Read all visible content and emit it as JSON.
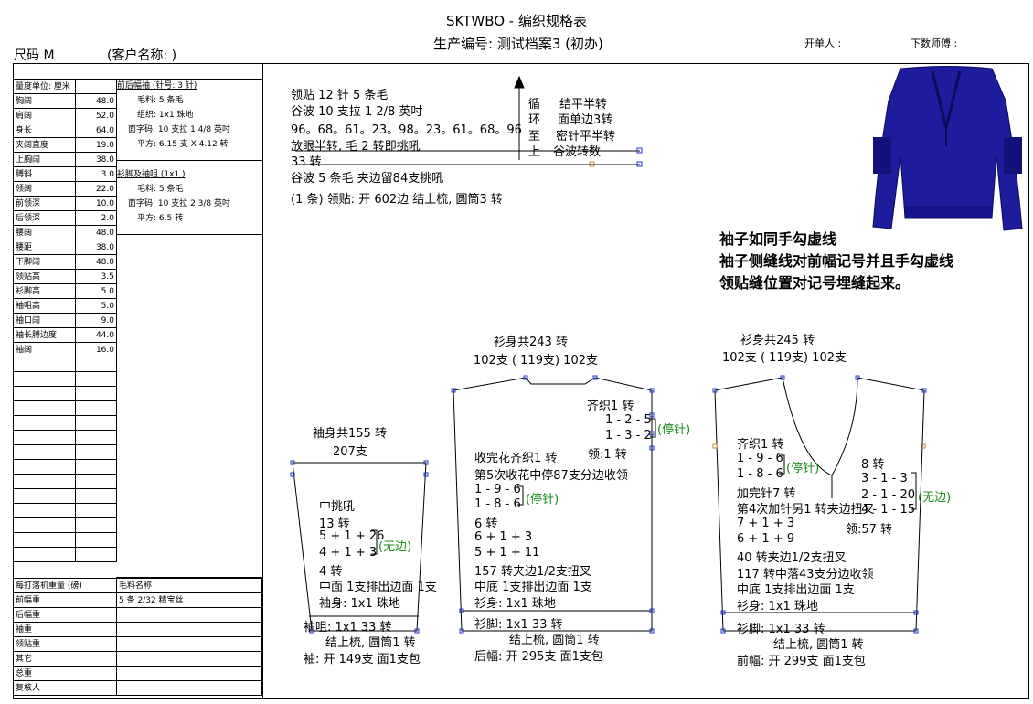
{
  "header": {
    "title": "SKTWBO - 编织规格表",
    "production_no": "生产编号: 测试档案3 (初办)",
    "size": "尺码  M",
    "customer": "(客户名称: )",
    "issuer": "开单人 :",
    "writer": "下数师傅 :"
  },
  "measure_table": {
    "unit_label": "量度单位: 厘米",
    "rows": [
      {
        "label": "胸阔",
        "value": "48.0"
      },
      {
        "label": "肩阔",
        "value": "52.0"
      },
      {
        "label": "身长",
        "value": "64.0"
      },
      {
        "label": "夹阔直度",
        "value": "19.0"
      },
      {
        "label": "上胸阔",
        "value": "38.0"
      },
      {
        "label": "膊斜",
        "value": "3.0"
      },
      {
        "label": "领阔",
        "value": "22.0"
      },
      {
        "label": "前领深",
        "value": "10.0"
      },
      {
        "label": "后领深",
        "value": "2.0"
      },
      {
        "label": "腰阔",
        "value": "48.0"
      },
      {
        "label": "腰距",
        "value": "38.0"
      },
      {
        "label": "下脚阔",
        "value": "48.0"
      },
      {
        "label": "领贴高",
        "value": "3.5"
      },
      {
        "label": "衫脚高",
        "value": "5.0"
      },
      {
        "label": "袖咀高",
        "value": "5.0"
      },
      {
        "label": "袖口阔",
        "value": "9.0"
      },
      {
        "label": "袖长膊边度",
        "value": "44.0"
      },
      {
        "label": "袖阔",
        "value": "16.0"
      }
    ]
  },
  "panel_notes": {
    "s1_title": "前后幅袖 (针号: 3 针)",
    "s1_lines": [
      "毛料: 5 条毛",
      "组织: 1x1  珠地",
      "面字码: 10 支拉 1 4/8 英吋",
      "平方: 6.15 支 X  4.12 转"
    ],
    "s2_title": "衫脚及袖咀 (1x1 )",
    "s2_lines": [
      "毛料: 5 条毛",
      "面字码: 10 支拉 2 3/8 英吋",
      "平方: 6.5 转"
    ]
  },
  "bottom_table": {
    "h1": "每打落机重量 (磅)",
    "h2": "毛料名称",
    "rows": [
      "前幅重",
      "后幅重",
      "袖重",
      "领贴重",
      "其它",
      "总重",
      "复核人"
    ],
    "yarn": "5 条 2/32 精宝丝"
  },
  "collar": {
    "lines": [
      "领贴  12 针 5 条毛",
      "谷波 10 支拉 1 2/8 英吋",
      "96。68。61。23。98。23。61。68。96",
      "放眼半转, 毛 2 转即挑吼",
      "33 转",
      "谷波 5 条毛     夹边留84支挑吼",
      "(1 条) 领贴: 开 602边 结上梳, 圆筒3 转"
    ],
    "loop_chars": [
      "循",
      "环",
      "至",
      "上"
    ],
    "loop_lines": [
      "结平半转",
      "面单边3转",
      "密针平半转",
      "谷波转数"
    ]
  },
  "bold_notes": [
    "袖子如同手勾虚线",
    "袖子侧缝线对前幅记号并且手勾虚线",
    "领贴缝位置对记号埋缝起来。"
  ],
  "sleeve": {
    "title": "袖身共155 转",
    "sub": "207支",
    "lines": [
      "中挑吼",
      "13 转",
      "5 + 1 + 26",
      "4 + 1 + 3",
      "4 转",
      "中面 1支排出边面 1支",
      "袖身: 1x1  珠地"
    ],
    "no_edge": "(无边)",
    "cuff": "袖咀: 1x1    33 转",
    "finish": "结上梳, 圆筒1 转",
    "open": "袖: 开 149支 面1支包"
  },
  "back": {
    "title": "衫身共243 转",
    "sub": "102支 ( 119支) 102支",
    "right_lines": [
      "齐织1 转",
      "1 - 2 - 5",
      "1 - 3 - 2",
      "领:1 转"
    ],
    "stop1": "(停针)",
    "lines": [
      "收完花齐织1 转",
      "第5次收花中停87支分边收领",
      "1 - 9 - 6",
      "1 - 8 - 6",
      "6 转",
      "6 + 1 + 3",
      "5 + 1 + 11",
      "157 转夹边1/2支扭叉",
      "中底 1支排出边面 1支",
      "衫身: 1x1  珠地"
    ],
    "stop2": "(停针)",
    "hem": "衫脚: 1x1    33 转",
    "finish": "结上梳, 圆筒1 转",
    "open": "后幅: 开 295支 面1支包"
  },
  "front": {
    "title": "衫身共245 转",
    "sub": "102支 ( 119支) 102支",
    "left_lines": [
      "齐织1 转",
      "1 - 9 - 6",
      "1 - 8 - 6",
      "加完针7 转"
    ],
    "stop": "(停针)",
    "right_lines": [
      "8 转",
      "3 - 1 - 3",
      "2 - 1 - 20",
      "4 - 1 - 15"
    ],
    "no_edge": "(无边)",
    "lines": [
      "第4次加针另1 转夹边扭叉",
      "7 + 1 + 3",
      "6 + 1 + 9",
      "40 转夹边1/2支扭叉",
      "117 转中落43支分边收领",
      "中底 1支排出边面 1支",
      "衫身: 1x1  珠地"
    ],
    "neck": "领:57 转",
    "hem": "衫脚: 1x1    33 转",
    "finish": "结上梳, 圆筒1 转",
    "open": "前幅: 开 299支 面1支包"
  }
}
